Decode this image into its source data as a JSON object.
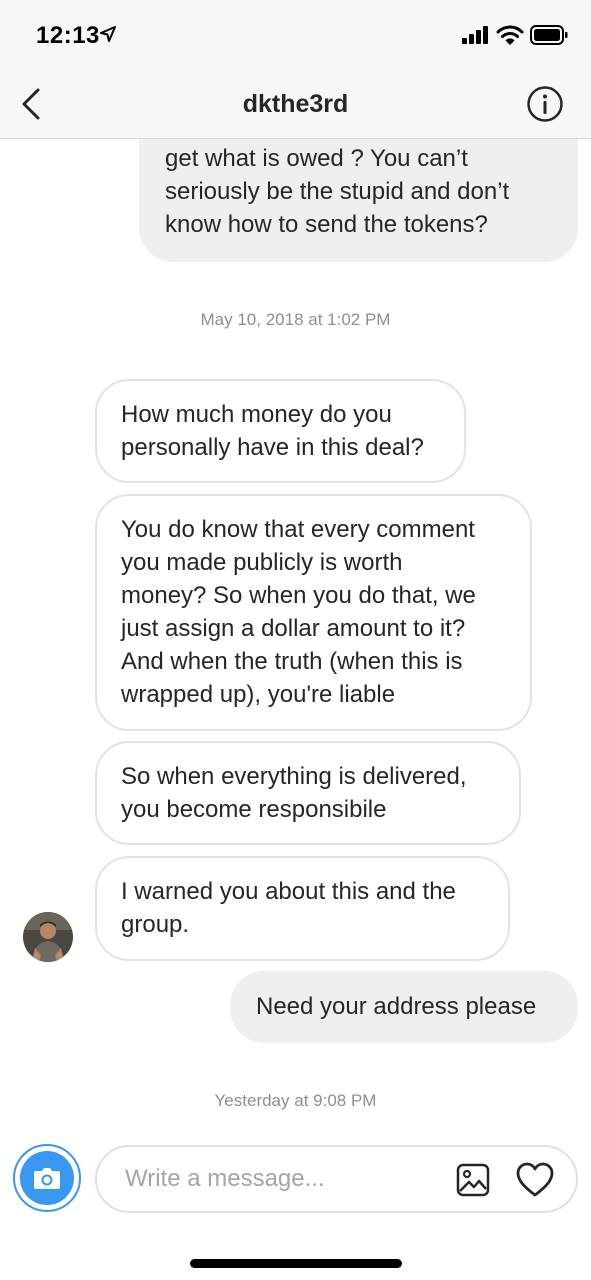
{
  "status_bar": {
    "time": "12:13",
    "icons": [
      "location-arrow-icon",
      "cellular-signal-icon",
      "wifi-icon",
      "battery-icon"
    ]
  },
  "header": {
    "title": "dkthe3rd",
    "back_icon": "chevron-left-icon",
    "info_icon": "info-circle-icon"
  },
  "messages": [
    {
      "direction": "outgoing",
      "text": "get what is owed ? You can’t\nseriously be the stupid and don’t\nknow how to send the tokens?"
    },
    {
      "timestamp": "May 10, 2018 at 1:02 PM"
    },
    {
      "direction": "incoming",
      "text": "How much money do you\npersonally have in this deal?"
    },
    {
      "direction": "incoming",
      "text": "You do know that every comment\nyou made publicly is worth\nmoney? So when you do that, we\njust assign a dollar amount to it?\nAnd when the truth (when this is\nwrapped up), you're liable"
    },
    {
      "direction": "incoming",
      "text": "So when everything is delivered,\nyou become responsibile"
    },
    {
      "direction": "incoming",
      "text": "I warned you about this and the\ngroup."
    },
    {
      "direction": "outgoing",
      "text": "Need your address please"
    },
    {
      "timestamp": "Yesterday at 9:08 PM"
    }
  ],
  "composer": {
    "placeholder": "Write a message...",
    "value": "",
    "icons": [
      "camera-icon",
      "gallery-icon",
      "heart-icon"
    ]
  },
  "colors": {
    "accent": "#3897f0",
    "outgoing_bubble": "#efefef",
    "incoming_border": "#e3e3e3",
    "timestamp_text": "#8e8e8e"
  }
}
